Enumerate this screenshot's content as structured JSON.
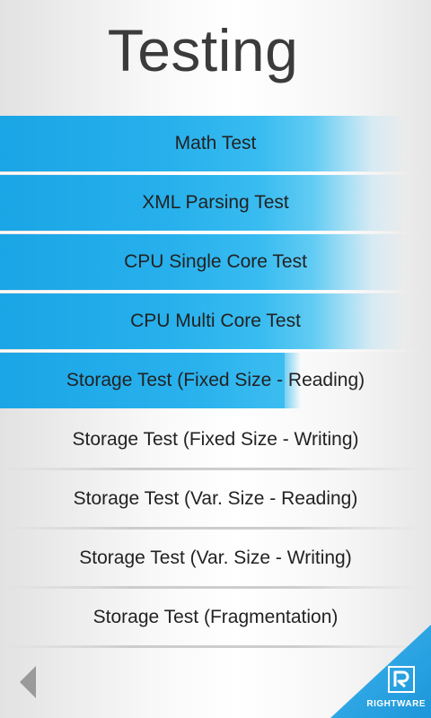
{
  "page": {
    "title": "Testing"
  },
  "tests": [
    {
      "label": "Math Test",
      "status": "done"
    },
    {
      "label": "XML Parsing Test",
      "status": "done"
    },
    {
      "label": "CPU Single Core Test",
      "status": "done"
    },
    {
      "label": "CPU Multi Core Test",
      "status": "done"
    },
    {
      "label": "Storage Test (Fixed Size - Reading)",
      "status": "running",
      "progress": 0.66
    },
    {
      "label": "Storage Test (Fixed Size - Writing)",
      "status": "pending"
    },
    {
      "label": "Storage Test (Var. Size - Reading)",
      "status": "pending"
    },
    {
      "label": "Storage Test (Var. Size - Writing)",
      "status": "pending"
    },
    {
      "label": "Storage Test (Fragmentation)",
      "status": "pending"
    }
  ],
  "footer": {
    "back_icon": "back-arrow-icon",
    "brand": "RIGHTWARE",
    "brand_icon": "rightware-logo-icon"
  },
  "colors": {
    "accent": "#27b0ec",
    "text": "#222222",
    "title": "#3b3b3b",
    "back_arrow": "#9a9a9a",
    "corner": "#1d96da"
  }
}
